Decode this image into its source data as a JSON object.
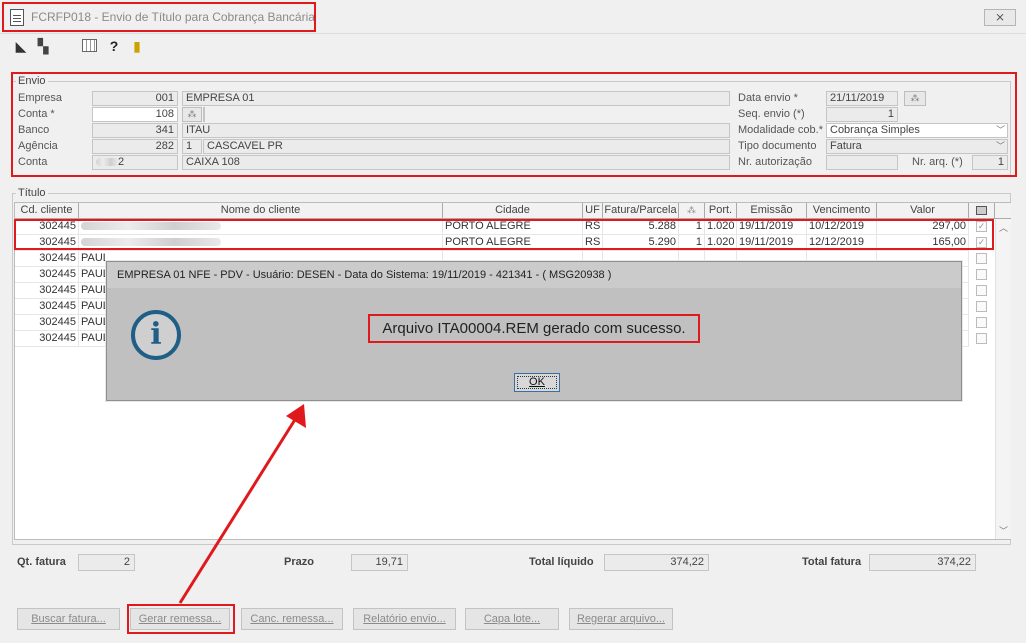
{
  "window": {
    "title": "FCRFP018 - Envio de Título para Cobrança Bancária",
    "close_label": "⨯"
  },
  "toolbar": {
    "icons": [
      "arrow-back-icon",
      "duplicate-icon",
      "calendar-grid-icon",
      "help-icon",
      "exit-door-icon"
    ]
  },
  "envio": {
    "legend": "Envio",
    "empresa": {
      "label": "Empresa",
      "code": "001",
      "name": "EMPRESA 01"
    },
    "conta": {
      "label": "Conta *",
      "code": "108"
    },
    "banco": {
      "label": "Banco",
      "code": "341",
      "name": "ITAU"
    },
    "agencia": {
      "label": "Agência",
      "code": "282",
      "digit": "1",
      "name": "CASCAVEL PR"
    },
    "conta2": {
      "label": "Conta",
      "code": "2",
      "name": "CAIXA 108"
    },
    "data_envio": {
      "label": "Data envio *",
      "value": "21/11/2019"
    },
    "seq_envio": {
      "label": "Seq. envio (*)",
      "value": "1"
    },
    "modalidade": {
      "label": "Modalidade cob.*",
      "value": "Cobrança Simples"
    },
    "tipo_documento": {
      "label": "Tipo documento",
      "value": "Fatura"
    },
    "nr_autorizacao": {
      "label": "Nr. autorização",
      "value": ""
    },
    "nr_arq": {
      "label": "Nr. arq. (*)",
      "value": "1"
    }
  },
  "titulo": {
    "legend": "Título",
    "columns": [
      "Cd. cliente",
      "Nome do cliente",
      "Cidade",
      "UF",
      "Fatura/Parcela",
      "",
      "Port.",
      "Emissão",
      "Vencimento",
      "Valor"
    ],
    "rows": [
      {
        "cd": "302445",
        "nome": "",
        "cidade": "PORTO ALEGRE",
        "uf": "RS",
        "fatura": "5.288",
        "parcela": "1",
        "port": "1.020",
        "emissao": "19/11/2019",
        "vencimento": "10/12/2019",
        "valor": "297,00",
        "checked": true
      },
      {
        "cd": "302445",
        "nome": "",
        "cidade": "PORTO ALEGRE",
        "uf": "RS",
        "fatura": "5.290",
        "parcela": "1",
        "port": "1.020",
        "emissao": "19/11/2019",
        "vencimento": "12/12/2019",
        "valor": "165,00",
        "checked": true
      },
      {
        "cd": "302445",
        "nome": "PAUL",
        "cidade": "",
        "uf": "",
        "fatura": "",
        "parcela": "",
        "port": "",
        "emissao": "",
        "vencimento": "",
        "valor": "",
        "checked": false
      },
      {
        "cd": "302445",
        "nome": "PAUL",
        "cidade": "",
        "uf": "",
        "fatura": "",
        "parcela": "",
        "port": "",
        "emissao": "",
        "vencimento": "",
        "valor": "",
        "checked": false
      },
      {
        "cd": "302445",
        "nome": "PAUL",
        "cidade": "",
        "uf": "",
        "fatura": "",
        "parcela": "",
        "port": "",
        "emissao": "",
        "vencimento": "",
        "valor": "",
        "checked": false
      },
      {
        "cd": "302445",
        "nome": "PAUL",
        "cidade": "",
        "uf": "",
        "fatura": "",
        "parcela": "",
        "port": "",
        "emissao": "",
        "vencimento": "",
        "valor": "",
        "checked": false
      },
      {
        "cd": "302445",
        "nome": "PAUL",
        "cidade": "",
        "uf": "",
        "fatura": "",
        "parcela": "",
        "port": "",
        "emissao": "",
        "vencimento": "",
        "valor": "",
        "checked": false
      },
      {
        "cd": "302445",
        "nome": "PAUL",
        "cidade": "",
        "uf": "",
        "fatura": "",
        "parcela": "",
        "port": "",
        "emissao": "",
        "vencimento": "",
        "valor": "",
        "checked": false
      }
    ]
  },
  "totals": {
    "qt_fatura_label": "Qt. fatura",
    "qt_fatura": "2",
    "prazo_label": "Prazo",
    "prazo": "19,71",
    "total_liquido_label": "Total líquido",
    "total_liquido": "374,22",
    "total_fatura_label": "Total fatura",
    "total_fatura": "374,22"
  },
  "buttons": {
    "buscar": "Buscar fatura...",
    "gerar": "Gerar remessa...",
    "canc": "Canc. remessa...",
    "relatorio": "Relatório envio...",
    "capa": "Capa lote...",
    "regerar": "Regerar arquivo..."
  },
  "dialog": {
    "title": "EMPRESA 01 NFE - PDV - Usuário: DESEN - Data do Sistema: 19/11/2019 - 421341 - ( MSG20938 )",
    "icon_glyph": "i",
    "message": "Arquivo ITA00004.REM gerado com sucesso.",
    "ok": "OK"
  },
  "colors": {
    "highlight": "#e0191d",
    "info_icon": "#1f5e86"
  }
}
